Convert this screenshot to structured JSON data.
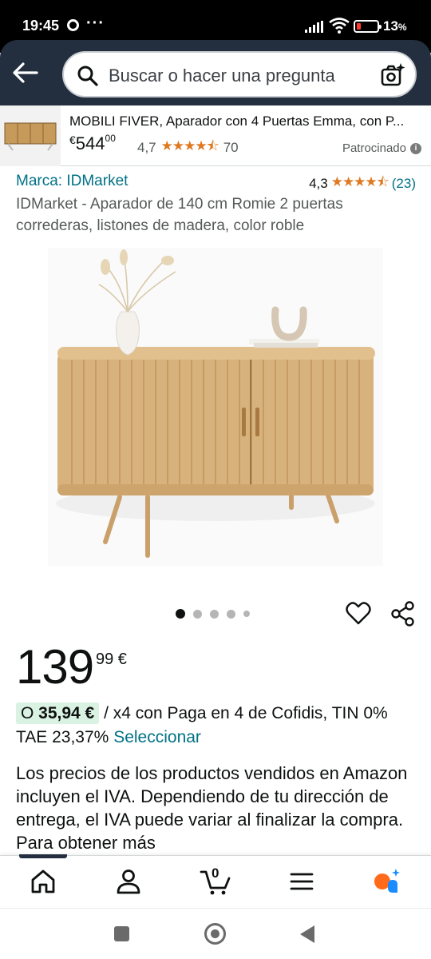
{
  "status_bar": {
    "time": "19:45",
    "overflow": "···",
    "battery_pct": "13",
    "battery_suffix": "%"
  },
  "header": {
    "back_icon": "arrow-left-icon",
    "search_placeholder": "Buscar o hacer una pregunta",
    "camera_icon": "camera-sparkle-icon"
  },
  "sponsored": {
    "title": "MOBILI FIVER, Aparador con 4 Puertas Emma, con P...",
    "currency": "€",
    "price_whole": "544",
    "price_cents": "00",
    "rating": "4,7",
    "stars": "★★★★⯪",
    "review_count": "70",
    "label": "Patrocinado",
    "info": "i"
  },
  "product": {
    "brand": "Marca: IDMarket",
    "rating": "4,3",
    "stars": "★★★★⯪",
    "review_count": "(23)",
    "title": "IDMarket - Aparador de 140 cm Romie 2 puertas correderas, listones de madera, color roble",
    "image_pages": 5,
    "image_current": 1,
    "price_whole": "139",
    "price_cents": "99 €",
    "install_prefix": "O ",
    "install_amount": "35,94 €",
    "install_text": " / x4 con Paga en 4 de Cofidis, TIN 0% TAE 23,37% ",
    "install_link": "Seleccionar",
    "vat_notice": "Los precios de los productos vendidos en Amazon incluyen el IVA. Dependiendo de tu dirección de entrega, el IVA puede variar al finalizar la compra. Para obtener más"
  },
  "bottom_nav": {
    "cart_count": "0",
    "tabs": [
      "home-icon",
      "account-icon",
      "cart-icon",
      "menu-icon",
      "rufus-icon"
    ]
  },
  "colors": {
    "header_bg": "#232f3e",
    "link": "#007185",
    "star": "#de7921",
    "badge_bg": "#d9f2e1"
  }
}
